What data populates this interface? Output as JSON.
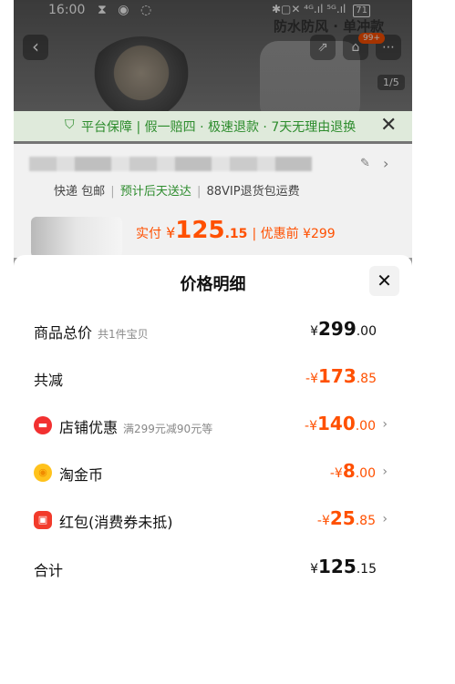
{
  "status_bar": {
    "time": "16:00",
    "left_icons": "⧗ ◉ ◌",
    "right_icons": "✱▢✕ ⁴ᴳ.ıl ⁵ᴳ.ıl",
    "battery": "71"
  },
  "header": {
    "brand_text": "防水防风 · 单冲款",
    "page_indicator": "1/5",
    "back_icon": "‹",
    "share_icon": "⇗",
    "cart_icon": "🛒",
    "more_icon": "⋯",
    "cart_badge": "99+"
  },
  "promise_bar": {
    "text": "平台保障 | 假一赔四 · 极速退款 · 7天无理由退换",
    "close": "✕"
  },
  "product_info": {
    "shipping_free": "快递 包邮",
    "sep": "|",
    "eta": "预计后天送达",
    "return_shipping": "88VIP退货包运费",
    "price_label": "实付",
    "currency": "¥",
    "price_int": "125",
    "price_dec": ".15",
    "orig_price": "优惠前 ¥299"
  },
  "sheet": {
    "title": "价格明细",
    "close": "✕",
    "rows": [
      {
        "name": "商品总价",
        "sub": "共1件宝贝",
        "currency": "¥",
        "int": "299",
        "dec": ".00",
        "color": "#111111"
      },
      {
        "name": "共减",
        "sub": "",
        "currency": "-¥",
        "int": "173",
        "dec": ".85",
        "color": "#ff5000"
      },
      {
        "name": "店铺优惠",
        "sub": "满299元减90元等",
        "currency": "-¥",
        "int": "140",
        "dec": ".00",
        "color": "#ff5000",
        "icon": "store-discount-icon"
      },
      {
        "name": "淘金币",
        "sub": "",
        "currency": "-¥",
        "int": "8",
        "dec": ".00",
        "color": "#ff5000",
        "icon": "gold-coin-icon"
      },
      {
        "name": "红包(消费券未抵)",
        "sub": "",
        "currency": "-¥",
        "int": "25",
        "dec": ".85",
        "color": "#ff5000",
        "icon": "red-packet-icon"
      },
      {
        "name": "合计",
        "sub": "",
        "currency": "¥",
        "int": "125",
        "dec": ".15",
        "color": "#111111"
      }
    ],
    "arrow": "›"
  },
  "colors": {
    "accent": "#ff5000",
    "green": "#2d8c2d"
  }
}
